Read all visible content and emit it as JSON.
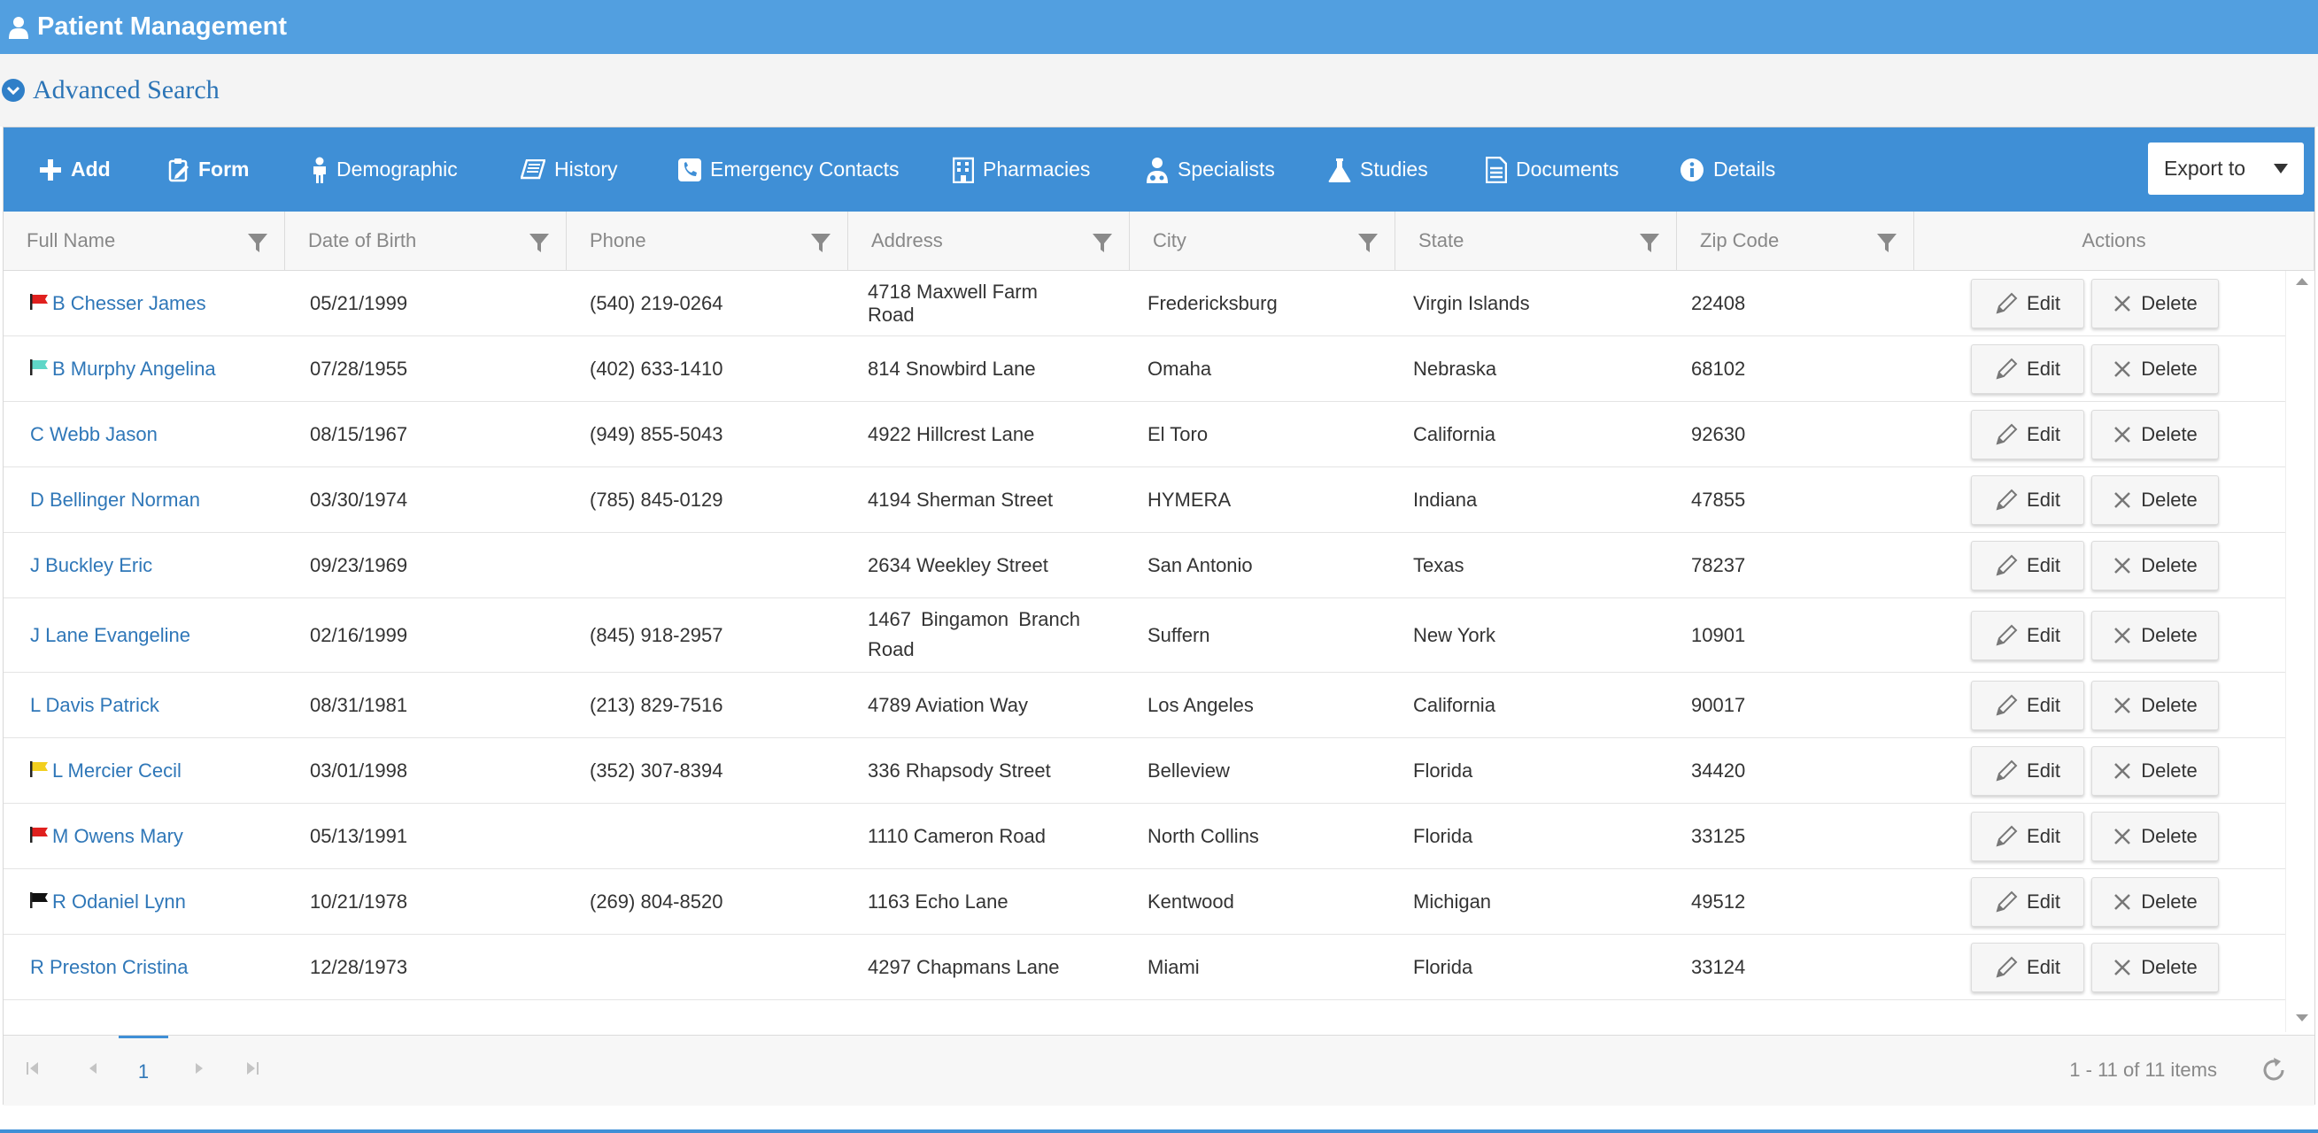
{
  "header": {
    "title": "Patient Management",
    "icon": "user-icon"
  },
  "search": {
    "label": "Advanced Search",
    "icon": "chevron-down-circle-icon"
  },
  "toolbar": {
    "buttons": [
      {
        "label": "Add",
        "icon": "plus-icon"
      },
      {
        "label": "Form",
        "icon": "form-icon"
      },
      {
        "label": "Demographic",
        "icon": "person-icon"
      },
      {
        "label": "History",
        "icon": "book-icon"
      },
      {
        "label": "Emergency Contacts",
        "icon": "phone-icon"
      },
      {
        "label": "Pharmacies",
        "icon": "building-icon"
      },
      {
        "label": "Specialists",
        "icon": "doctor-icon"
      },
      {
        "label": "Studies",
        "icon": "flask-icon"
      },
      {
        "label": "Documents",
        "icon": "document-icon"
      },
      {
        "label": "Details",
        "icon": "info-icon"
      }
    ],
    "export_label": "Export to"
  },
  "columns": [
    "Full Name",
    "Date of Birth",
    "Phone",
    "Address",
    "City",
    "State",
    "Zip Code",
    "Actions"
  ],
  "actions": {
    "edit": "Edit",
    "delete": "Delete"
  },
  "rows": [
    {
      "name": "B Chesser James",
      "flag": "#e0201e",
      "dob": "05/21/1999",
      "phone": "(540) 219-0264",
      "address": "4718 Maxwell Farm Road",
      "city": "Fredericksburg",
      "state": "Virgin Islands",
      "zip": "22408"
    },
    {
      "name": "B Murphy Angelina",
      "flag": "#5fd6c8",
      "dob": "07/28/1955",
      "phone": "(402) 633-1410",
      "address": "814 Snowbird Lane",
      "city": "Omaha",
      "state": "Nebraska",
      "zip": "68102"
    },
    {
      "name": "C Webb Jason",
      "flag": "",
      "dob": "08/15/1967",
      "phone": "(949) 855-5043",
      "address": "4922 Hillcrest Lane",
      "city": "El Toro",
      "state": "California",
      "zip": "92630"
    },
    {
      "name": "D Bellinger Norman",
      "flag": "",
      "dob": "03/30/1974",
      "phone": "(785) 845-0129",
      "address": "4194 Sherman Street",
      "city": "HYMERA",
      "state": "Indiana",
      "zip": "47855"
    },
    {
      "name": "J Buckley Eric",
      "flag": "",
      "dob": "09/23/1969",
      "phone": "",
      "address": "2634 Weekley Street",
      "city": "San Antonio",
      "state": "Texas",
      "zip": "78237"
    },
    {
      "name": "J Lane Evangeline",
      "flag": "",
      "dob": "02/16/1999",
      "phone": "(845) 918-2957",
      "address": "1467 Bingamon Branch Road",
      "city": "Suffern",
      "state": "New York",
      "zip": "10901"
    },
    {
      "name": "L Davis Patrick",
      "flag": "",
      "dob": "08/31/1981",
      "phone": "(213) 829-7516",
      "address": "4789 Aviation Way",
      "city": "Los Angeles",
      "state": "California",
      "zip": "90017"
    },
    {
      "name": "L Mercier Cecil",
      "flag": "#f2cf1f",
      "dob": "03/01/1998",
      "phone": "(352) 307-8394",
      "address": "336 Rhapsody Street",
      "city": "Belleview",
      "state": "Florida",
      "zip": "34420"
    },
    {
      "name": "M Owens Mary",
      "flag": "#e0201e",
      "dob": "05/13/1991",
      "phone": "",
      "address": "1110 Cameron Road",
      "city": "North Collins",
      "state": "Florida",
      "zip": "33125"
    },
    {
      "name": "R Odaniel Lynn",
      "flag": "#111111",
      "dob": "10/21/1978",
      "phone": "(269) 804-8520",
      "address": "1163 Echo Lane",
      "city": "Kentwood",
      "state": "Michigan",
      "zip": "49512"
    },
    {
      "name": "R Preston Cristina",
      "flag": "",
      "dob": "12/28/1973",
      "phone": "",
      "address": "4297 Chapmans Lane",
      "city": "Miami",
      "state": "Florida",
      "zip": "33124"
    }
  ],
  "pager": {
    "current_page": "1",
    "summary": "1 - 11 of 11 items"
  },
  "colors": {
    "header": "#529fe0",
    "toolbar": "#3f8fd6",
    "link": "#2f77b8"
  }
}
